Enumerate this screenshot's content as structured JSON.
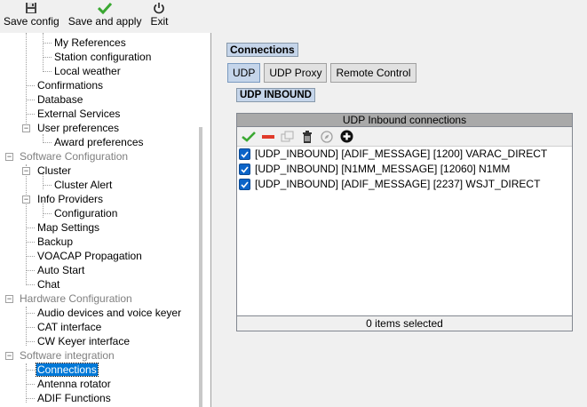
{
  "toolbar": {
    "save_config": "Save config",
    "save_and_apply": "Save and apply",
    "exit": "Exit"
  },
  "tree": {
    "my_references": "My References",
    "station_configuration": "Station configuration",
    "local_weather": "Local weather",
    "confirmations": "Confirmations",
    "database": "Database",
    "external_services": "External Services",
    "user_preferences": "User preferences",
    "award_preferences": "Award preferences",
    "software_configuration": "Software Configuration",
    "cluster": "Cluster",
    "cluster_alert": "Cluster Alert",
    "info_providers": "Info Providers",
    "configuration": "Configuration",
    "map_settings": "Map Settings",
    "backup": "Backup",
    "voacap_propagation": "VOACAP Propagation",
    "auto_start": "Auto Start",
    "chat": "Chat",
    "hardware_configuration": "Hardware Configuration",
    "audio_devices": "Audio devices and voice keyer",
    "cat_interface": "CAT interface",
    "cw_keyer_interface": "CW Keyer interface",
    "software_integration": "Software integration",
    "connections": "Connections",
    "antenna_rotator": "Antenna rotator",
    "adif_functions": "ADIF Functions"
  },
  "main": {
    "title": "Connections",
    "tabs": [
      "UDP",
      "UDP Proxy",
      "Remote Control"
    ],
    "active_tab": "UDP",
    "subtitle": "UDP INBOUND",
    "list": {
      "header": "UDP Inbound connections",
      "items": [
        "[UDP_INBOUND] [ADIF_MESSAGE] [1200] VARAC_DIRECT",
        "[UDP_INBOUND] [N1MM_MESSAGE] [12060] N1MM",
        "[UDP_INBOUND] [ADIF_MESSAGE] [2237] WSJT_DIRECT"
      ],
      "footer": "0 items selected"
    }
  },
  "colors": {
    "accent": "#0078d7",
    "title_bg": "#c5d5ea",
    "checkbox": "#0b64c8"
  },
  "icons": [
    "save-icon",
    "check-icon",
    "power-icon",
    "minus-icon",
    "copy-icon",
    "trash-icon",
    "compass-icon",
    "add-icon"
  ]
}
